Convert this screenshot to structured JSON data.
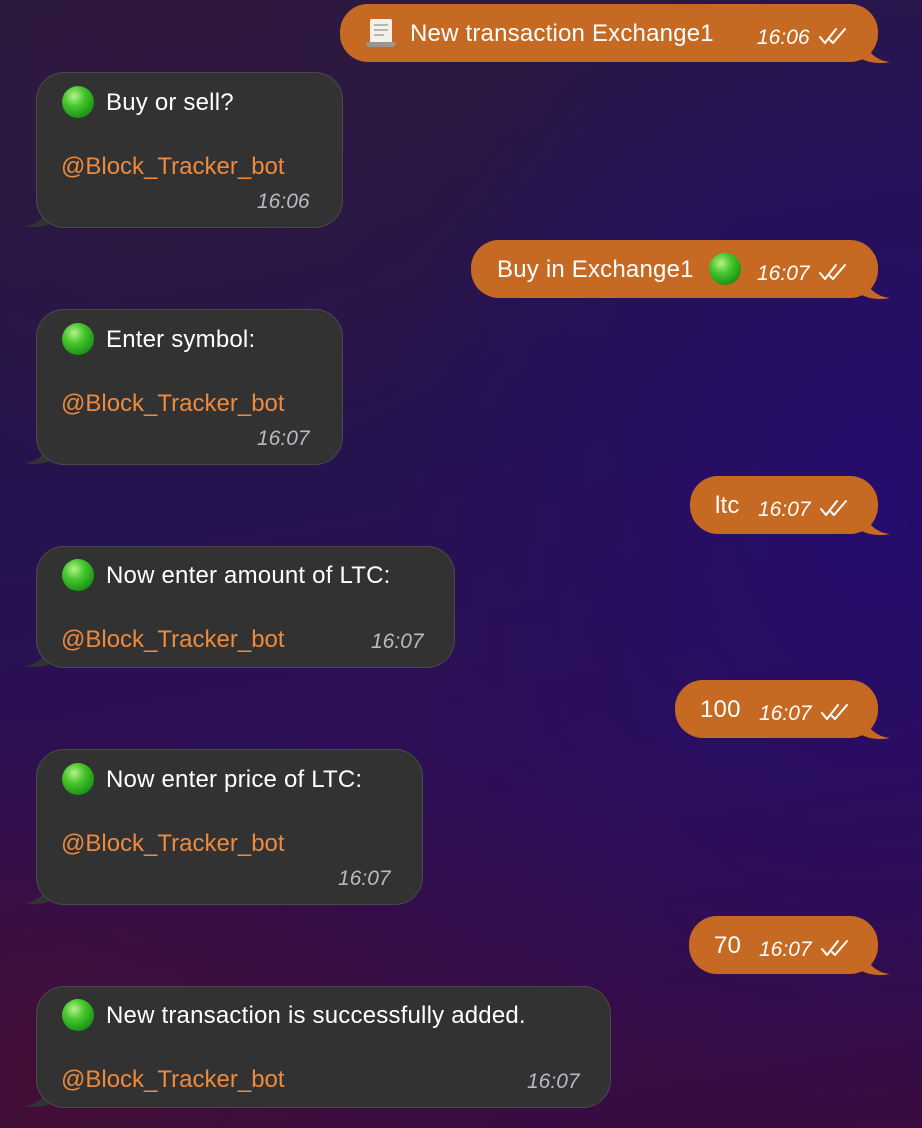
{
  "chat": {
    "messages": [
      {
        "direction": "outgoing",
        "icon": "receipt-icon",
        "text": "New transaction Exchange1",
        "time": "16:06",
        "status": "read"
      },
      {
        "direction": "incoming",
        "icon": "green-circle-icon",
        "text": "Buy or sell?",
        "via": "@Block_Tracker_bot",
        "time": "16:06"
      },
      {
        "direction": "outgoing",
        "text": "Buy in Exchange1",
        "trailing_icon": "green-circle-icon",
        "time": "16:07",
        "status": "read"
      },
      {
        "direction": "incoming",
        "icon": "green-circle-icon",
        "text": "Enter symbol:",
        "via": "@Block_Tracker_bot",
        "time": "16:07"
      },
      {
        "direction": "outgoing",
        "text": "ltc",
        "time": "16:07",
        "status": "read"
      },
      {
        "direction": "incoming",
        "icon": "green-circle-icon",
        "text": "Now enter amount of LTC:",
        "via": "@Block_Tracker_bot",
        "time": "16:07"
      },
      {
        "direction": "outgoing",
        "text": "100",
        "time": "16:07",
        "status": "read"
      },
      {
        "direction": "incoming",
        "icon": "green-circle-icon",
        "text": "Now enter price of LTC:",
        "via": "@Block_Tracker_bot",
        "time": "16:07"
      },
      {
        "direction": "outgoing",
        "text": "70",
        "time": "16:07",
        "status": "read"
      },
      {
        "direction": "incoming",
        "icon": "green-circle-icon",
        "text": "New transaction is successfully added.",
        "via": "@Block_Tracker_bot",
        "time": "16:07"
      }
    ]
  },
  "colors": {
    "outgoing_bubble": "#c66a23",
    "incoming_bubble": "#323232",
    "bot_handle": "#ee8a3e"
  }
}
